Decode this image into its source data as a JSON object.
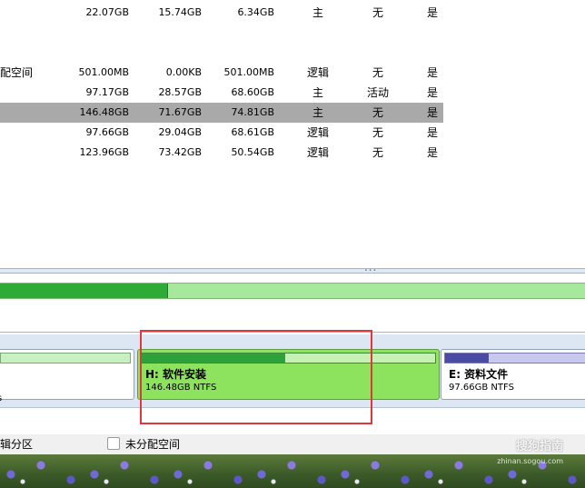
{
  "partitions": [
    {
      "name": "",
      "capacity": "22.07GB",
      "used": "15.74GB",
      "free": "6.34GB",
      "type": "主",
      "status": "无",
      "fault": "是"
    },
    {
      "name": "配空间",
      "capacity": "501.00MB",
      "used": "0.00KB",
      "free": "501.00MB",
      "type": "逻辑",
      "status": "无",
      "fault": "是"
    },
    {
      "name": "",
      "capacity": "97.17GB",
      "used": "28.57GB",
      "free": "68.60GB",
      "type": "主",
      "status": "活动",
      "fault": "是"
    },
    {
      "name": "",
      "capacity": "146.48GB",
      "used": "71.67GB",
      "free": "74.81GB",
      "type": "主",
      "status": "无",
      "fault": "是"
    },
    {
      "name": "",
      "capacity": "97.66GB",
      "used": "29.04GB",
      "free": "68.61GB",
      "type": "逻辑",
      "status": "无",
      "fault": "是"
    },
    {
      "name": "",
      "capacity": "123.96GB",
      "used": "73.42GB",
      "free": "50.54GB",
      "type": "逻辑",
      "status": "无",
      "fault": "是"
    }
  ],
  "selected_row": 3,
  "disk_usage_fraction": 0.285,
  "disk_map": {
    "left_glyph": "s",
    "h": {
      "label": "H: 软件安装",
      "size": "146.48GB NTFS",
      "used_fraction": 0.49
    },
    "e": {
      "label": "E: 资料文件",
      "size": "97.66GB NTFS",
      "used_fraction": 0.3
    }
  },
  "splitter_grip": "∙∙∙",
  "legend": {
    "logical": "辑分区",
    "unallocated": "未分配空间"
  },
  "watermark": {
    "text": "搜狗指南",
    "url": "zhinan.sogou.com"
  },
  "colors": {
    "selection": "#a9a9a9",
    "primary_used": "#2eaa36",
    "primary_free": "#a6e89c",
    "logical_used": "#4b4ba6",
    "highlight": "#e0383a"
  }
}
